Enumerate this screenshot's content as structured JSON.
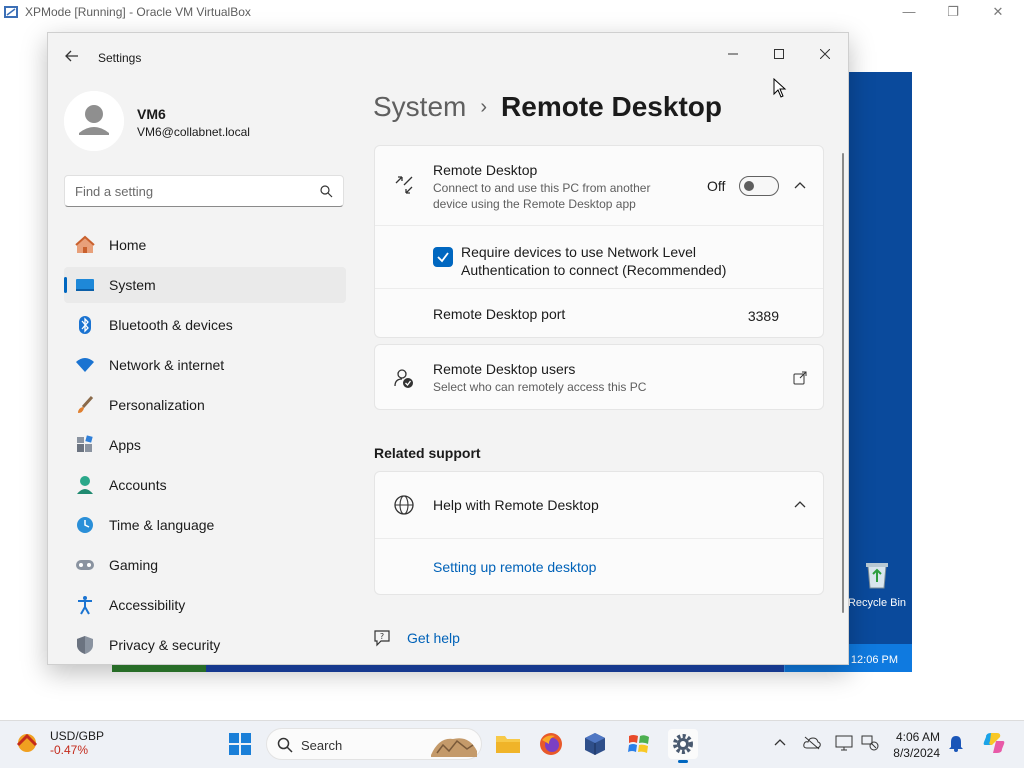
{
  "vbox": {
    "title": "XPMode [Running] - Oracle VM VirtualBox",
    "icon": "virtualbox-icon"
  },
  "guest_desktop": {
    "recycle_bin_label": "Recycle Bin",
    "clock": "12:06 PM"
  },
  "settings": {
    "window_title": "Settings",
    "profile": {
      "name": "VM6",
      "email": "VM6@collabnet.local"
    },
    "search_placeholder": "Find a setting",
    "nav": [
      {
        "label": "Home",
        "icon": "home-icon"
      },
      {
        "label": "System",
        "icon": "system-icon"
      },
      {
        "label": "Bluetooth & devices",
        "icon": "bluetooth-icon"
      },
      {
        "label": "Network & internet",
        "icon": "wifi-icon"
      },
      {
        "label": "Personalization",
        "icon": "brush-icon"
      },
      {
        "label": "Apps",
        "icon": "apps-icon"
      },
      {
        "label": "Accounts",
        "icon": "accounts-icon"
      },
      {
        "label": "Time & language",
        "icon": "globe-clock-icon"
      },
      {
        "label": "Gaming",
        "icon": "gamepad-icon"
      },
      {
        "label": "Accessibility",
        "icon": "accessibility-icon"
      },
      {
        "label": "Privacy & security",
        "icon": "shield-icon"
      }
    ],
    "selected_nav": "System",
    "breadcrumb": {
      "parent": "System",
      "separator": "›",
      "current": "Remote Desktop"
    },
    "remote_desktop": {
      "title": "Remote Desktop",
      "subtitle": "Connect to and use this PC from another device using the Remote Desktop app",
      "toggle_state": "Off",
      "nla_label": "Require devices to use Network Level Authentication to connect (Recommended)",
      "nla_checked": true,
      "port_label": "Remote Desktop port",
      "port_value": "3389"
    },
    "users": {
      "title": "Remote Desktop users",
      "subtitle": "Select who can remotely access this PC"
    },
    "related_support": {
      "heading": "Related support",
      "help_title": "Help with Remote Desktop",
      "link": "Setting up remote desktop"
    },
    "get_help": "Get help"
  },
  "taskbar": {
    "widget": {
      "title": "USD/GBP",
      "value": "-0.47%"
    },
    "search_label": "Search",
    "pinned": [
      "start-icon",
      "file-explorer-icon",
      "firefox-icon",
      "virtualbox-icon",
      "windows-xp-icon",
      "settings-icon"
    ],
    "active_app": "settings-icon",
    "clock": {
      "time": "4:06 AM",
      "date": "8/3/2024"
    }
  },
  "colors": {
    "accent": "#0067c0",
    "link": "#0062b8",
    "negative": "#c42b1c",
    "xp_blue": "#0a4a9c"
  }
}
